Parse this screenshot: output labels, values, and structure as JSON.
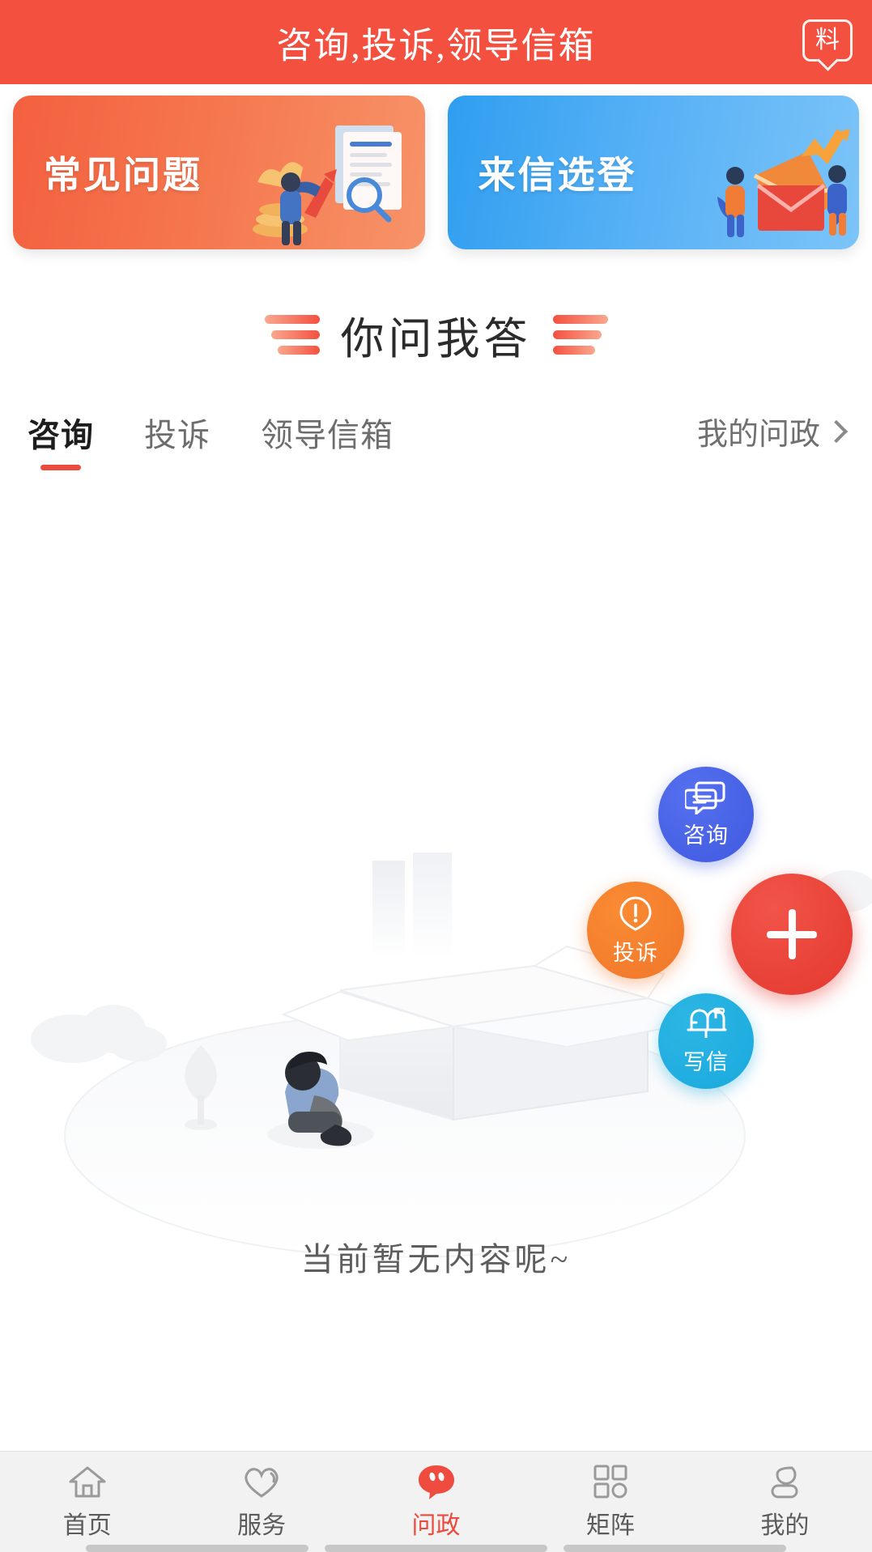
{
  "header": {
    "title": "咨询,投诉,领导信箱",
    "action_icon_label": "料",
    "bg_color": "#f4503f"
  },
  "banners": [
    {
      "label": "常见问题",
      "theme": "orange",
      "accent": "#f4603f"
    },
    {
      "label": "来信选登",
      "theme": "blue",
      "accent": "#2f9ef0"
    }
  ],
  "section": {
    "title": "你问我答"
  },
  "tabs": {
    "items": [
      {
        "label": "咨询",
        "active": true
      },
      {
        "label": "投诉",
        "active": false
      },
      {
        "label": "领导信箱",
        "active": false
      }
    ],
    "my_link": "我的问政",
    "active_color": "#ec4a3c"
  },
  "empty_state": {
    "text": "当前暂无内容呢~"
  },
  "fabs": [
    {
      "name": "consult",
      "label": "咨询",
      "color": "#4059e0"
    },
    {
      "name": "complaint",
      "label": "投诉",
      "color": "#f0762a"
    },
    {
      "name": "letter",
      "label": "写信",
      "color": "#1aa9dd"
    },
    {
      "name": "main",
      "label": "+",
      "color": "#e3382e"
    }
  ],
  "bottom_nav": {
    "items": [
      {
        "label": "首页",
        "icon": "home-icon",
        "active": false
      },
      {
        "label": "服务",
        "icon": "heart-icon",
        "active": false
      },
      {
        "label": "问政",
        "icon": "chat-icon",
        "active": true
      },
      {
        "label": "矩阵",
        "icon": "grid-icon",
        "active": false
      },
      {
        "label": "我的",
        "icon": "person-icon",
        "active": false
      }
    ],
    "active_color": "#ec4a3c"
  }
}
